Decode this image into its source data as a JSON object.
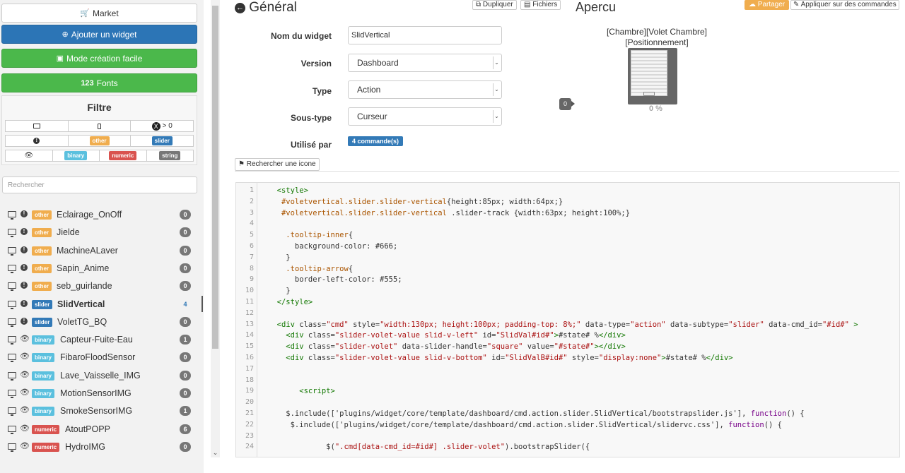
{
  "sidebar": {
    "market": "Market",
    "ajouter": "Ajouter un widget",
    "mode_creation": "Mode création facile",
    "fonts": "Fonts",
    "fonts_icon": "123",
    "filtre": {
      "title": "Filtre",
      "x_count": "> 0",
      "labels": [
        "other",
        "slider",
        "binary",
        "numeric",
        "string"
      ]
    },
    "search_placeholder": "Rechercher",
    "widgets": [
      {
        "type": "other",
        "name": "Eclairage_OnOff",
        "count": "0",
        "icon": "info-icon"
      },
      {
        "type": "other",
        "name": "Jielde",
        "count": "0",
        "icon": "info-icon"
      },
      {
        "type": "other",
        "name": "MachineALaver",
        "count": "0",
        "icon": "info-icon"
      },
      {
        "type": "other",
        "name": "Sapin_Anime",
        "count": "0",
        "icon": "info-icon"
      },
      {
        "type": "other",
        "name": "seb_guirlande",
        "count": "0",
        "icon": "info-icon"
      },
      {
        "type": "slider",
        "name": "SlidVertical",
        "count": "4",
        "icon": "info-icon",
        "active": true
      },
      {
        "type": "slider",
        "name": "VoletTG_BQ",
        "count": "0",
        "icon": "info-icon"
      },
      {
        "type": "binary",
        "name": "Capteur-Fuite-Eau",
        "count": "1",
        "icon": "eye-icon"
      },
      {
        "type": "binary",
        "name": "FibaroFloodSensor",
        "count": "0",
        "icon": "eye-icon"
      },
      {
        "type": "binary",
        "name": "Lave_Vaisselle_IMG",
        "count": "0",
        "icon": "eye-icon"
      },
      {
        "type": "binary",
        "name": "MotionSensorIMG",
        "count": "0",
        "icon": "eye-icon"
      },
      {
        "type": "binary",
        "name": "SmokeSensorIMG",
        "count": "1",
        "icon": "eye-icon"
      },
      {
        "type": "numeric",
        "name": "AtoutPOPP",
        "count": "6",
        "icon": "eye-icon"
      },
      {
        "type": "numeric",
        "name": "HydroIMG",
        "count": "0",
        "icon": "eye-icon"
      }
    ]
  },
  "general": {
    "title": "Général",
    "dupliquer": "Dupliquer",
    "fichiers": "Fichiers",
    "nom_label": "Nom du widget",
    "nom_value": "SlidVertical",
    "version_label": "Version",
    "version_value": "Dashboard",
    "type_label": "Type",
    "type_value": "Action",
    "soustype_label": "Sous-type",
    "soustype_value": "Curseur",
    "utilise_label": "Utilisé par",
    "utilise_value": "4 commande(s)",
    "rechercher_icone": "Rechercher une icone"
  },
  "apercu": {
    "title": "Apercu",
    "partager": "Partager",
    "appliquer": "Appliquer sur des commandes",
    "name": "[Chambre][Volet Chambre][Positionnement]",
    "name_line1": "[Chambre][Volet Chambre]",
    "name_line2": "[Positionnement]",
    "tooltip": "0",
    "percent": "0 %",
    "slider_level": 0
  },
  "code": {
    "line_numbers": [
      "1",
      "2",
      "3",
      "4",
      "5",
      "6",
      "7",
      "8",
      "9",
      "10",
      "11",
      "12",
      "13",
      "14",
      "15",
      "16",
      "17",
      "18",
      "19",
      "20",
      "21",
      "22",
      "23",
      "24"
    ],
    "lines": [
      "  <style>",
      "   #voletvertical.slider.slider-vertical{height:85px; width:64px;}",
      "   #voletvertical.slider.slider-vertical .slider-track {width:63px; height:100%;}",
      "",
      "    .tooltip-inner{",
      "      background-color: #666;",
      "    }",
      "    .tooltip-arrow{",
      "      border-left-color: #555;",
      "    }",
      "  </style>",
      "",
      "  <div class=\"cmd\" style=\"width:130px; height:100px; padding-top: 8%;\" data-type=\"action\" data-subtype=\"slider\" data-cmd_id=\"#id#\" >",
      "    <div class=\"slider-volet-value slid-v-left\" id=\"SlidVal#id#\">#state# %</div>",
      "    <div class=\"slider-volet\" data-slider-handle=\"square\" value=\"#state#\"></div>",
      "    <div class=\"slider-volet-value slid-v-bottom\" id=\"SlidValB#id#\" style=\"display:none\">#state# %</div>",
      "",
      "",
      "       <script>",
      "",
      "    $.include(['plugins/widget/core/template/dashboard/cmd.action.slider.SlidVertical/bootstrapslider.js'], function() {",
      "     $.include(['plugins/widget/core/template/dashboard/cmd.action.slider.SlidVertical/slidervc.css'], function() {",
      "",
      "             $(\".cmd[data-cmd_id=#id#] .slider-volet\").bootstrapSlider({"
    ]
  },
  "colors": {
    "primary": "#337ab7",
    "success": "#4bb84b",
    "warning": "#f0ad4e",
    "info": "#5bc0de",
    "danger": "#d9534f",
    "default": "#777777"
  }
}
